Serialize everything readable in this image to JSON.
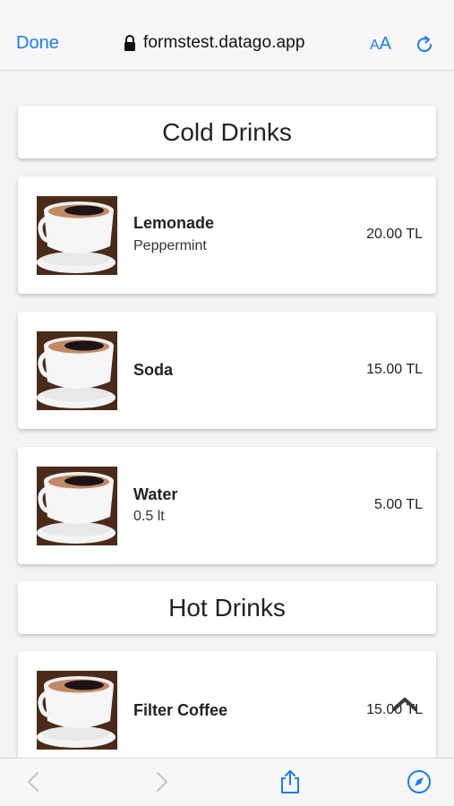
{
  "browser": {
    "done_label": "Done",
    "url": "formstest.datago.app",
    "text_size_small": "A",
    "text_size_large": "A"
  },
  "sections": [
    {
      "title": "Cold Drinks",
      "items": [
        {
          "name": "Lemonade",
          "description": "Peppermint",
          "price": "20.00 TL"
        },
        {
          "name": "Soda",
          "description": "",
          "price": "15.00 TL"
        },
        {
          "name": "Water",
          "description": "0.5 lt",
          "price": "5.00 TL"
        }
      ]
    },
    {
      "title": "Hot Drinks",
      "items": [
        {
          "name": "Filter Coffee",
          "description": "",
          "price": "15.00 TL"
        }
      ]
    }
  ],
  "icons": {
    "lock": "lock-icon",
    "reload": "reload-icon",
    "back": "chevron-left-icon",
    "forward": "chevron-right-icon",
    "share": "share-icon",
    "compass": "compass-icon",
    "scroll_top": "chevron-up-icon"
  },
  "colors": {
    "accent": "#1b7cf2",
    "disabled": "#c4c4c4"
  }
}
